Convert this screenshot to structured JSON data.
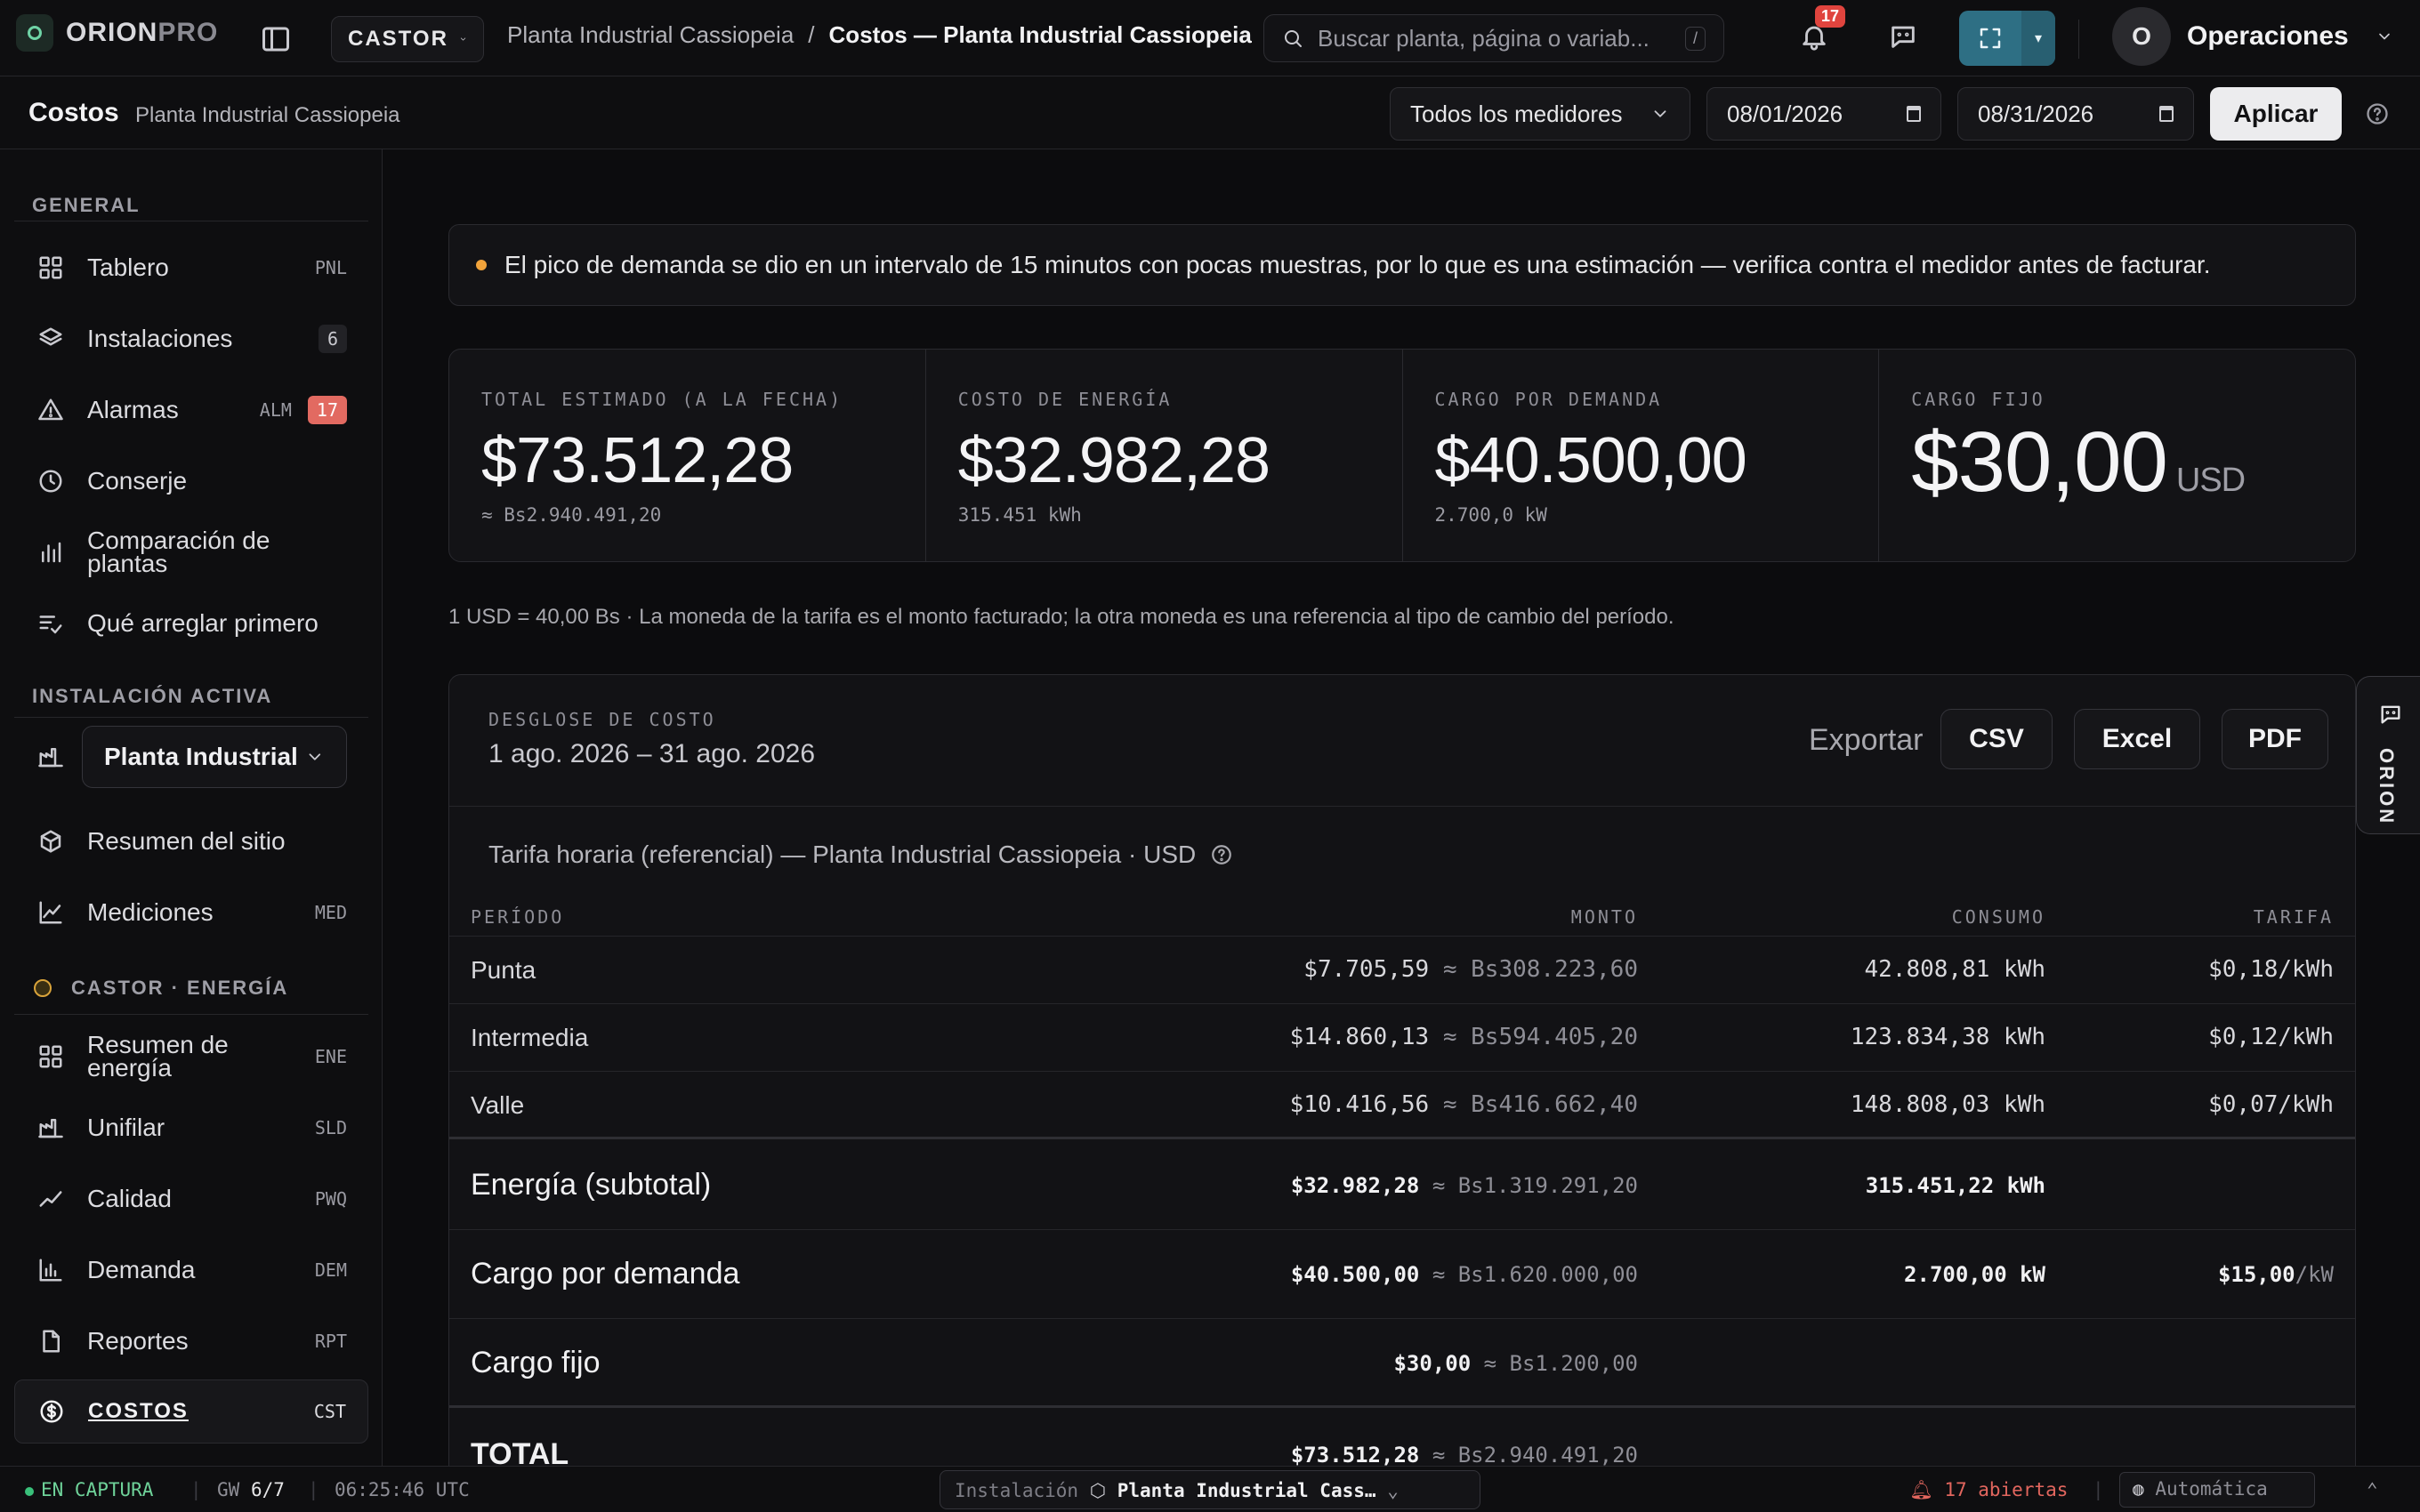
{
  "app": {
    "brand_a": "ORION",
    "brand_b": "PRO",
    "org": "CASTOR",
    "breadcrumb": {
      "parent": "Planta Industrial Cassiopeia",
      "sep": "/",
      "current": "Costos — Planta Industrial Cassiopeia"
    },
    "search": {
      "placeholder": "Buscar planta, página o variab...",
      "shortcut": "/"
    },
    "notifications": "17",
    "user": {
      "initial": "O",
      "name": "Operaciones"
    }
  },
  "subheader": {
    "title": "Costos",
    "site": "Planta Industrial Cassiopeia",
    "meter": "Todos los medidores",
    "date_from": "08/01/2026",
    "date_to": "08/31/2026",
    "apply": "Aplicar"
  },
  "sidebar": {
    "section_general": "GENERAL",
    "general": [
      {
        "label": "Tablero",
        "kbd": "PNL",
        "icon": "grid-icon"
      },
      {
        "label": "Instalaciones",
        "count": "6",
        "icon": "layers-icon"
      },
      {
        "label": "Alarmas",
        "kbd": "ALM",
        "badge": "17",
        "icon": "warning-icon"
      },
      {
        "label": "Conserje",
        "icon": "clock-icon"
      },
      {
        "label": "Comparación de plantas",
        "icon": "bar-chart-icon"
      },
      {
        "label": "Qué arreglar primero",
        "icon": "checklist-icon"
      }
    ],
    "section_active": "INSTALACIÓN ACTIVA",
    "plant_select": "Planta Industrial Cassiopeia",
    "active": [
      {
        "label": "Resumen del sitio",
        "icon": "cube-icon"
      },
      {
        "label": "Mediciones",
        "kbd": "MED",
        "icon": "line-chart-icon"
      }
    ],
    "section_energy": "CASTOR · ENERGÍA",
    "energy": [
      {
        "label": "Resumen de energía",
        "kbd": "ENE",
        "icon": "grid-icon"
      },
      {
        "label": "Unifilar",
        "kbd": "SLD",
        "icon": "factory-icon"
      },
      {
        "label": "Calidad",
        "kbd": "PWQ",
        "icon": "trend-icon"
      },
      {
        "label": "Demanda",
        "kbd": "DEM",
        "icon": "bar-chart-icon"
      },
      {
        "label": "Reportes",
        "kbd": "RPT",
        "icon": "document-icon"
      },
      {
        "label": "Costos",
        "kbd": "CST",
        "icon": "dollar-icon"
      }
    ]
  },
  "alert": "El pico de demanda se dio en un intervalo de 15 minutos con pocas muestras, por lo que es una estimación — verifica contra el medidor antes de facturar.",
  "kpis": [
    {
      "label": "TOTAL ESTIMADO (A LA FECHA)",
      "value": "$73.512,28",
      "sub": "≈ Bs2.940.491,20"
    },
    {
      "label": "COSTO DE ENERGÍA",
      "value": "$32.982,28",
      "sub": "315.451 kWh"
    },
    {
      "label": "CARGO POR DEMANDA",
      "value": "$40.500,00",
      "sub": "2.700,0 kW"
    },
    {
      "label": "CARGO FIJO",
      "value": "$30,00",
      "unit": "USD"
    }
  ],
  "fx_note": "1 USD = 40,00 Bs · La moneda de la tarifa es el monto facturado; la otra moneda es una referencia al tipo de cambio del período.",
  "breakdown": {
    "kicker": "DESGLOSE DE COSTO",
    "range": "1 ago. 2026 – 31 ago. 2026",
    "export_label": "Exportar",
    "csv": "CSV",
    "excel": "Excel",
    "pdf": "PDF",
    "tariff": "Tarifa horaria (referencial) — Planta Industrial Cassiopeia · USD",
    "columns": {
      "period": "PERÍODO",
      "amount": "MONTO",
      "consumption": "CONSUMO",
      "rate": "TARIFA"
    },
    "rows": [
      {
        "period": "Punta",
        "amount": "$7.705,59",
        "alt": "≈ Bs308.223,60",
        "consumption": "42.808,81 kWh",
        "rate": "$0,18/kWh"
      },
      {
        "period": "Intermedia",
        "amount": "$14.860,13",
        "alt": "≈ Bs594.405,20",
        "consumption": "123.834,38 kWh",
        "rate": "$0,12/kWh"
      },
      {
        "period": "Valle",
        "amount": "$10.416,56",
        "alt": "≈ Bs416.662,40",
        "consumption": "148.808,03 kWh",
        "rate": "$0,07/kWh"
      }
    ],
    "subtotal": {
      "period": "Energía (subtotal)",
      "amount": "$32.982,28",
      "alt": "≈ Bs1.319.291,20",
      "consumption": "315.451,22 kWh"
    },
    "demand": {
      "period": "Cargo por demanda",
      "amount": "$40.500,00",
      "alt": "≈ Bs1.620.000,00",
      "consumption": "2.700,00 kW",
      "rate": "$15,00",
      "rate_unit": "/kW"
    },
    "fixed": {
      "period": "Cargo fijo",
      "amount": "$30,00",
      "alt": "≈ Bs1.200,00"
    },
    "total": {
      "period": "TOTAL",
      "amount": "$73.512,28",
      "alt": "≈ Bs2.940.491,20"
    }
  },
  "side_tab": "ORION",
  "status": {
    "live": "EN CAPTURA",
    "gw_label": "GW",
    "gw": "6/7",
    "time": "06:25:46 UTC",
    "inst_label": "Instalación",
    "inst_value": "Planta Industrial Cass…",
    "open": "17 abiertas",
    "auto": "Automática"
  }
}
